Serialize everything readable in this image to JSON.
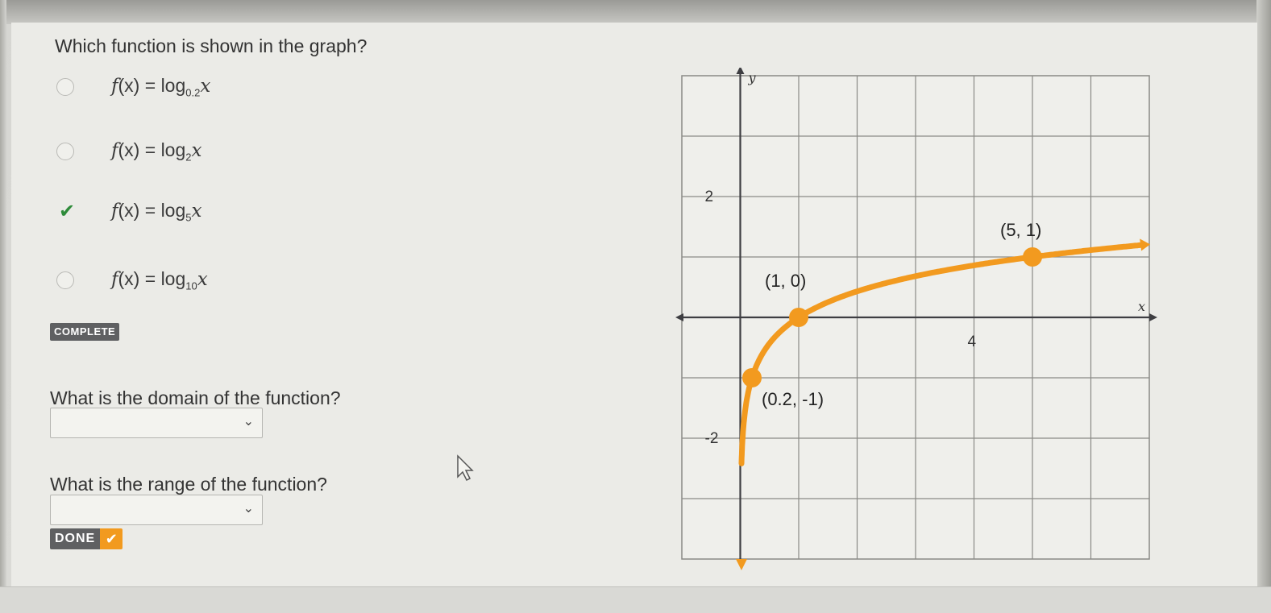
{
  "question": "Which function is shown in the graph?",
  "options": [
    {
      "fn": "f",
      "arg": "(x)",
      "op": " = ",
      "log": "log",
      "base": "0.2",
      "var": "x",
      "state": "unselected"
    },
    {
      "fn": "f",
      "arg": "(x)",
      "op": " = ",
      "log": "log",
      "base": "2",
      "var": "x",
      "state": "unselected"
    },
    {
      "fn": "f",
      "arg": "(x)",
      "op": " = ",
      "log": "log",
      "base": "5",
      "var": "x",
      "state": "correct"
    },
    {
      "fn": "f",
      "arg": "(x)",
      "op": " = ",
      "log": "log",
      "base": "10",
      "var": "x",
      "state": "unselected"
    }
  ],
  "complete_badge": "COMPLETE",
  "domain_question": "What is the domain of the function?",
  "domain_value": "",
  "range_question": "What is the range of the function?",
  "range_value": "",
  "done_label": "DONE",
  "done_icon": "✔",
  "check_icon": "✔",
  "chevron_icon": "⌄",
  "colors": {
    "curve": "#f29a1f",
    "check": "#2e8b3a",
    "badge": "#5f6062",
    "grid": "#8a8a86"
  },
  "graph": {
    "x_axis_label": "x",
    "y_axis_label": "y",
    "tick_labels": [
      {
        "text": "2",
        "axis": "y",
        "value": 2
      },
      {
        "text": "-2",
        "axis": "y",
        "value": -2
      },
      {
        "text": "4",
        "axis": "x",
        "value": 4
      }
    ],
    "points": [
      {
        "x": 0.2,
        "y": -1,
        "label": "(0.2, -1)"
      },
      {
        "x": 1,
        "y": 0,
        "label": "(1, 0)"
      },
      {
        "x": 5,
        "y": 1,
        "label": "(5, 1)"
      }
    ],
    "x_range": [
      -1,
      7
    ],
    "y_range": [
      -4,
      4
    ],
    "grid": true,
    "function": "log base 5 of x"
  }
}
